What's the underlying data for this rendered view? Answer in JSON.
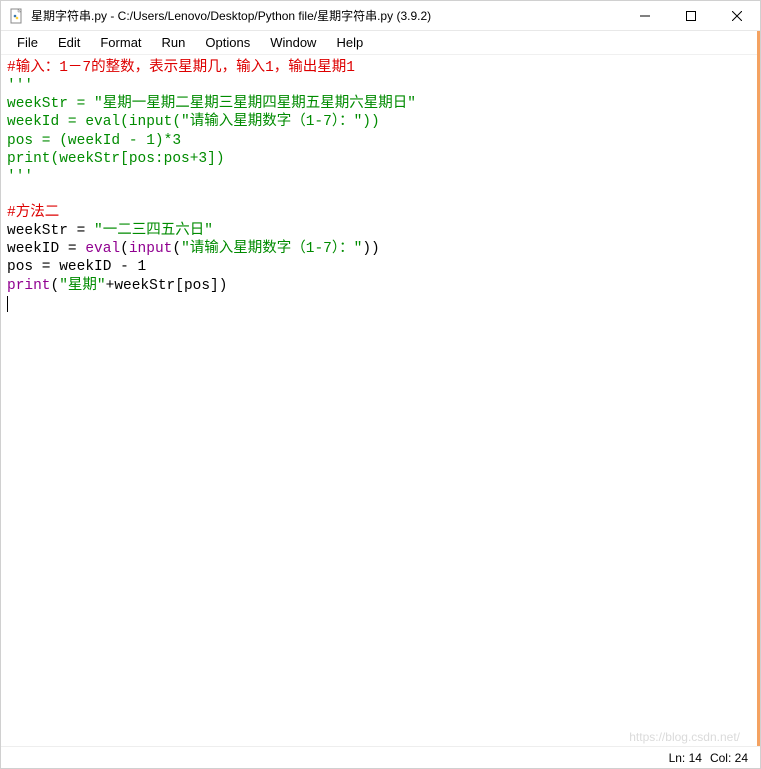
{
  "window": {
    "title": "星期字符串.py - C:/Users/Lenovo/Desktop/Python file/星期字符串.py (3.9.2)",
    "icon": "python-file-icon"
  },
  "menu": {
    "items": [
      "File",
      "Edit",
      "Format",
      "Run",
      "Options",
      "Window",
      "Help"
    ]
  },
  "code": {
    "line1": {
      "t": "#输入：1－7的整数，表示星期几，输入1，输出星期1"
    },
    "line2": {
      "t": "'''"
    },
    "line3": {
      "a": "weekStr = \"星期一星期二星期三星期四星期五星期六星期日\""
    },
    "line4": {
      "a": "weekId = eval(input(\"请输入星期数字（1-7）：\"))"
    },
    "line5": {
      "a": "pos = (weekId - 1)*3"
    },
    "line6": {
      "a": "print(weekStr[pos:pos+3])"
    },
    "line7": {
      "a": "'''"
    },
    "line9": {
      "t": "#方法二"
    },
    "line10": {
      "a": "weekStr = ",
      "b": "\"一二三四五六日\""
    },
    "line11": {
      "a": "weekID = ",
      "b": "eval",
      "c": "(",
      "d": "input",
      "e": "(",
      "f": "\"请输入星期数字（1-7）：\"",
      "g": "))"
    },
    "line12": {
      "a": "pos = weekID - 1"
    },
    "line13": {
      "a": "print",
      "b": "(",
      "c": "\"星期\"",
      "d": "+weekStr[pos])"
    }
  },
  "status": {
    "ln_label": "Ln: ",
    "ln_val": "14",
    "col_label": "Col: ",
    "col_val": "24"
  },
  "watermark": "https://blog.csdn.net/"
}
